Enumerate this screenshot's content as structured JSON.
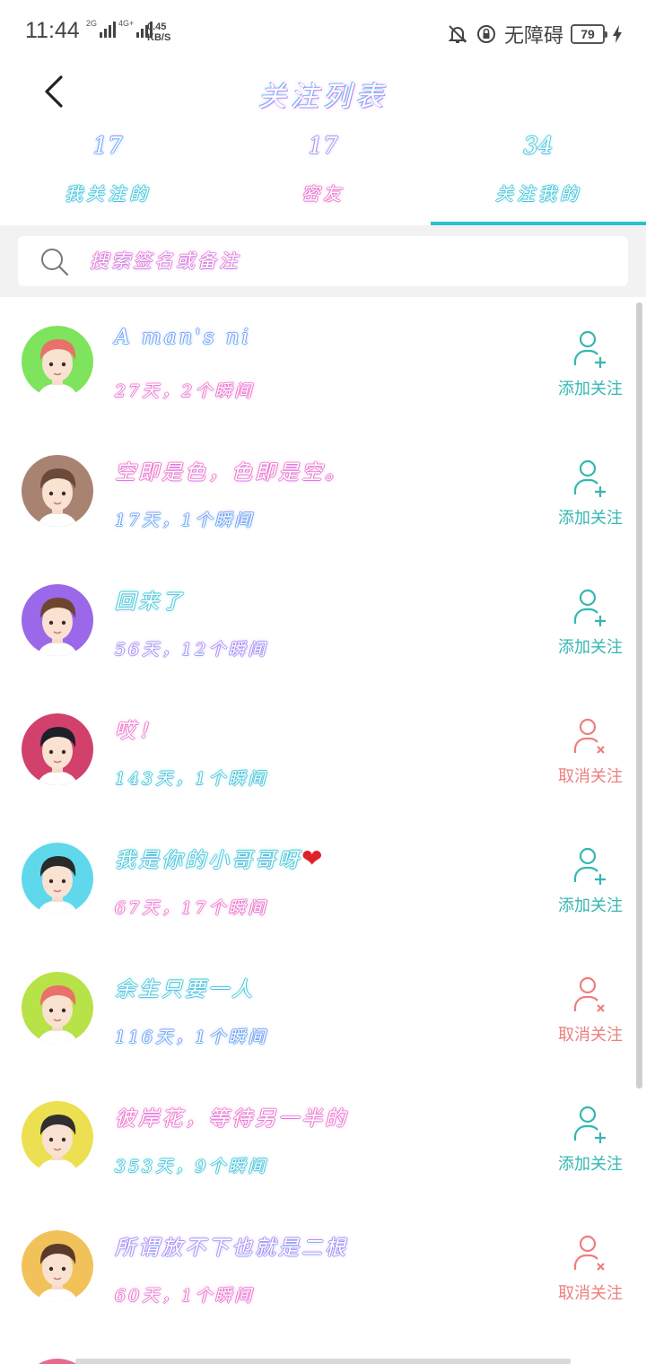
{
  "status_bar": {
    "time": "11:44",
    "net1": "2G",
    "net2": "4G+",
    "speed_value": "0.45",
    "speed_unit": "KB/S",
    "accessibility": "无障碍",
    "battery": "79",
    "icons": [
      "bell-off-icon",
      "lock-rotation-icon",
      "charging-icon"
    ]
  },
  "header": {
    "title": "关注列表",
    "back_icon": "chevron-left-icon"
  },
  "tabs": [
    {
      "count": "17",
      "label": "我关注的",
      "active": false
    },
    {
      "count": "17",
      "label": "密友",
      "active": false
    },
    {
      "count": "34",
      "label": "关注我的",
      "active": true
    }
  ],
  "search": {
    "placeholder": "搜索签名或备注",
    "icon": "search-icon"
  },
  "colors": {
    "accent": "#29c2c9",
    "add": "#34b7b0",
    "cancel": "#ec7f7f"
  },
  "users": [
    {
      "name": "A man's ni",
      "meta": "27天，2个瞬间",
      "action": "添加关注",
      "action_type": "add",
      "avatar_bg": "#7ee35d",
      "hair": "#e9716a"
    },
    {
      "name": "空即是色，色即是空。",
      "meta": "17天，1个瞬间",
      "action": "添加关注",
      "action_type": "add",
      "avatar_bg": "#a88372",
      "hair": "#6b4a3a"
    },
    {
      "name": "回来了",
      "meta": "56天，12个瞬间",
      "action": "添加关注",
      "action_type": "add",
      "avatar_bg": "#9a68e8",
      "hair": "#6e4630"
    },
    {
      "name": "哎！",
      "meta": "143天，1个瞬间",
      "action": "取消关注",
      "action_type": "cancel",
      "avatar_bg": "#d2416c",
      "hair": "#1f1f2a"
    },
    {
      "name": "我是你的小哥哥呀",
      "heart": "❤",
      "meta": "67天，17个瞬间",
      "action": "添加关注",
      "action_type": "add",
      "avatar_bg": "#5fd8ec",
      "hair": "#2a2a2a"
    },
    {
      "name": "余生只要一人",
      "meta": "116天，1个瞬间",
      "action": "取消关注",
      "action_type": "cancel",
      "avatar_bg": "#b7e248",
      "hair": "#e9716a"
    },
    {
      "name": "彼岸花，等待另一半的",
      "meta": "353天，9个瞬间",
      "action": "添加关注",
      "action_type": "add",
      "avatar_bg": "#ece052",
      "hair": "#2f2f2f"
    },
    {
      "name": "所谓放不下也就是二根",
      "meta": "60天，1个瞬间",
      "action": "取消关注",
      "action_type": "cancel",
      "avatar_bg": "#f2c25a",
      "hair": "#5a3a2a"
    }
  ]
}
